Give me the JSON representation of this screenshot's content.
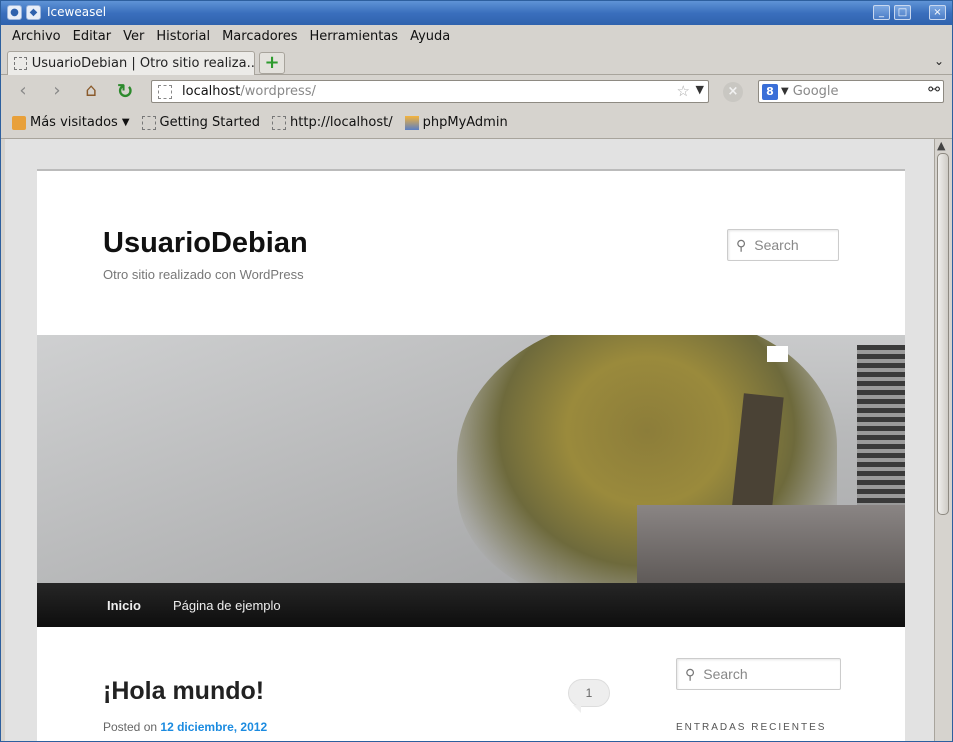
{
  "window": {
    "title": "Iceweasel",
    "controls": [
      "_",
      "□",
      "×"
    ]
  },
  "menu": [
    "Archivo",
    "Editar",
    "Ver",
    "Historial",
    "Marcadores",
    "Herramientas",
    "Ayuda"
  ],
  "tab": {
    "label": "UsuarioDebian | Otro sitio realiza...",
    "new_tab_symbol": "+",
    "list_symbol": "⌄"
  },
  "url": {
    "host": "localhost",
    "path": "/wordpress/"
  },
  "browser_search": {
    "placeholder": "Google",
    "engine_letter": "8"
  },
  "bookmarks": [
    "Más visitados",
    "Getting Started",
    "http://localhost/",
    "phpMyAdmin"
  ],
  "site": {
    "title": "UsuarioDebian",
    "description": "Otro sitio realizado con WordPress",
    "search_placeholder": "Search"
  },
  "nav": [
    "Inicio",
    "Página de ejemplo"
  ],
  "post": {
    "title": "¡Hola mundo!",
    "posted_on": "Posted on",
    "date": "12 diciembre, 2012",
    "comment_count": "1"
  },
  "sidebar": {
    "search_placeholder": "Search",
    "widget_title": "ENTRADAS RECIENTES"
  },
  "icons": {
    "back": "back-arrow-icon",
    "forward": "forward-arrow-icon",
    "home": "home-icon",
    "reload": "reload-icon",
    "stop": "stop-icon",
    "bookmark_star": "star-icon",
    "search_go": "binoculars-icon"
  },
  "colors": {
    "titlebar": "#3a6fbd",
    "link": "#1b8be0",
    "navmenu": "#111111"
  }
}
